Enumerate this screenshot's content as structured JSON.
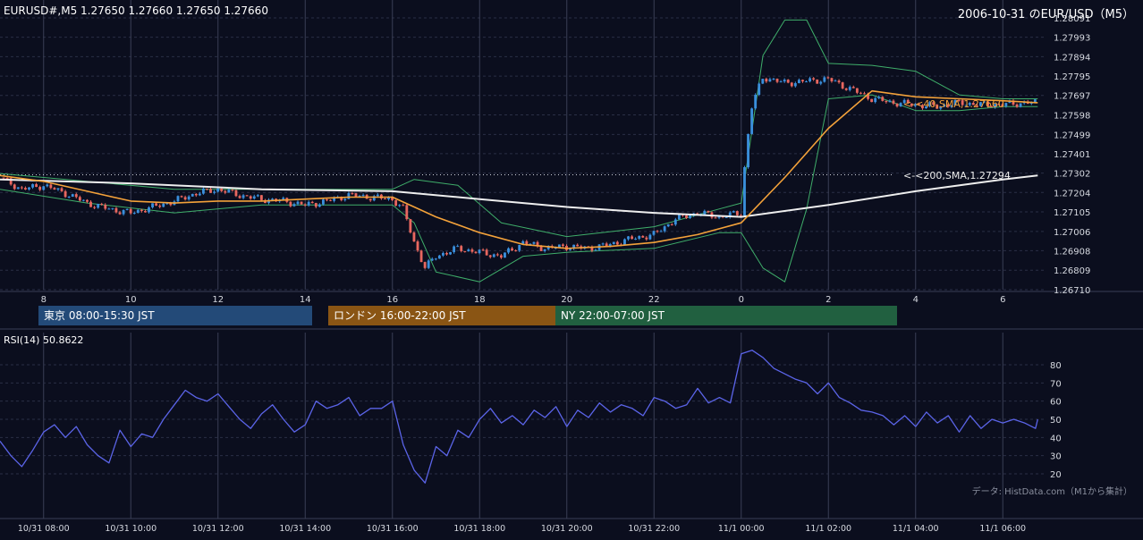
{
  "header": {
    "symbol_ohlc": "EURUSD#,M5 1.27650 1.27660 1.27650 1.27660",
    "title": "2006-10-31 のEUR/USD（M5）"
  },
  "colors": {
    "background": "#0b0e1e",
    "grid": "#2a2f45",
    "candle_up": "#3a8fdc",
    "candle_down": "#e8675f",
    "sma40": "#f4a23a",
    "sma200": "#eeeeee",
    "bollinger": "#3fae6a",
    "rsi": "#5b64e8"
  },
  "sessions": [
    {
      "label": "東京 08:00-15:30 JST",
      "color": "#234a78"
    },
    {
      "label": "ロンドン 16:00-22:00 JST",
      "color": "#8a5514"
    },
    {
      "label": "NY 22:00-07:00 JST",
      "color": "#216040"
    }
  ],
  "indicators": {
    "sma40_label": "<-<40,SMA,1.27660",
    "sma200_label": "<-<200,SMA,1.27294",
    "rsi_label": "RSI(14) 50.8622"
  },
  "source_note": "データ: HistData.com（M1から集計）",
  "chart_data": [
    {
      "type": "line",
      "name": "price",
      "y_ticks": [
        "1.28091",
        "1.27993",
        "1.27894",
        "1.27795",
        "1.27697",
        "1.27598",
        "1.27499",
        "1.27401",
        "1.27302",
        "1.27204",
        "1.27105",
        "1.27006",
        "1.26908",
        "1.26809",
        "1.26710"
      ],
      "ylim": [
        1.2671,
        1.28091
      ],
      "x_ticks": [
        "8",
        "10",
        "12",
        "14",
        "16",
        "18",
        "20",
        "22",
        "0",
        "2",
        "4",
        "6"
      ],
      "x_tick_hours": [
        8,
        10,
        12,
        14,
        16,
        18,
        20,
        22,
        24,
        26,
        28,
        30
      ],
      "xlim_hours": [
        7.0,
        31.0
      ],
      "reference_line": 1.27294,
      "series": [
        {
          "name": "price",
          "x_hours": [
            7.0,
            7.5,
            8.0,
            8.5,
            9.0,
            9.5,
            10.0,
            10.5,
            11.0,
            11.5,
            12.0,
            12.5,
            13.0,
            13.5,
            14.0,
            14.5,
            15.0,
            15.5,
            16.0,
            16.25,
            16.5,
            16.75,
            17.0,
            17.5,
            18.0,
            18.5,
            19.0,
            19.5,
            20.0,
            20.5,
            21.0,
            21.5,
            22.0,
            22.5,
            23.0,
            23.5,
            24.0,
            24.1,
            24.25,
            24.5,
            25.0,
            25.5,
            26.0,
            26.5,
            27.0,
            27.5,
            28.0,
            28.5,
            29.0,
            29.5,
            30.0,
            30.5,
            30.8
          ],
          "values": [
            1.2728,
            1.2722,
            1.2724,
            1.272,
            1.2715,
            1.2712,
            1.271,
            1.2713,
            1.2716,
            1.272,
            1.2722,
            1.2719,
            1.2717,
            1.2716,
            1.2714,
            1.2716,
            1.2719,
            1.2718,
            1.2717,
            1.2712,
            1.2695,
            1.2682,
            1.2688,
            1.2692,
            1.269,
            1.2688,
            1.2695,
            1.2692,
            1.2693,
            1.2692,
            1.2694,
            1.2697,
            1.2699,
            1.2707,
            1.271,
            1.2708,
            1.271,
            1.274,
            1.2765,
            1.2779,
            1.2776,
            1.2777,
            1.2778,
            1.2773,
            1.2768,
            1.2766,
            1.2765,
            1.2764,
            1.2766,
            1.2765,
            1.2765,
            1.2766,
            1.2766
          ]
        },
        {
          "name": "SMA40",
          "x_hours": [
            7.0,
            8.0,
            9.0,
            10.0,
            11.0,
            12.0,
            13.0,
            14.0,
            15.0,
            16.0,
            16.5,
            17.0,
            18.0,
            19.0,
            20.0,
            21.0,
            22.0,
            23.0,
            24.0,
            25.0,
            26.0,
            27.0,
            28.0,
            29.0,
            30.0,
            30.8
          ],
          "values": [
            1.2729,
            1.2726,
            1.2721,
            1.2716,
            1.2715,
            1.2716,
            1.2716,
            1.2717,
            1.2718,
            1.2718,
            1.2713,
            1.2708,
            1.27,
            1.2694,
            1.2692,
            1.2693,
            1.2695,
            1.2699,
            1.2705,
            1.2728,
            1.2753,
            1.2772,
            1.2769,
            1.2768,
            1.2767,
            1.2766
          ]
        },
        {
          "name": "SMA200",
          "x_hours": [
            7.0,
            10.0,
            13.0,
            16.0,
            18.0,
            20.0,
            22.0,
            24.0,
            26.0,
            28.0,
            30.0,
            30.8
          ],
          "values": [
            1.2727,
            1.2725,
            1.2722,
            1.2721,
            1.2717,
            1.2713,
            1.271,
            1.2708,
            1.2714,
            1.2721,
            1.2727,
            1.2729
          ]
        },
        {
          "name": "BB upper",
          "x_hours": [
            7.0,
            9.0,
            11.0,
            13.0,
            15.0,
            16.0,
            16.5,
            17.5,
            18.5,
            20.0,
            22.0,
            23.5,
            24.0,
            24.5,
            25.0,
            25.5,
            26.0,
            27.0,
            28.0,
            29.0,
            30.0,
            30.8
          ],
          "values": [
            1.273,
            1.2726,
            1.2722,
            1.2722,
            1.2722,
            1.2722,
            1.2727,
            1.2724,
            1.2705,
            1.2698,
            1.2703,
            1.2712,
            1.2715,
            1.279,
            1.2808,
            1.2808,
            1.2786,
            1.2785,
            1.2782,
            1.277,
            1.2768,
            1.2768
          ]
        },
        {
          "name": "BB lower",
          "x_hours": [
            7.0,
            9.0,
            11.0,
            13.0,
            15.0,
            16.0,
            16.5,
            17.0,
            18.0,
            19.0,
            20.0,
            22.0,
            23.5,
            24.0,
            24.5,
            25.0,
            25.5,
            26.0,
            27.0,
            28.0,
            29.0,
            30.0,
            30.8
          ],
          "values": [
            1.2722,
            1.2715,
            1.271,
            1.2714,
            1.2714,
            1.2714,
            1.2705,
            1.268,
            1.2675,
            1.2688,
            1.269,
            1.2692,
            1.27,
            1.27,
            1.2682,
            1.2675,
            1.2712,
            1.2768,
            1.277,
            1.2762,
            1.2762,
            1.2764,
            1.2764
          ]
        }
      ]
    },
    {
      "type": "line",
      "name": "RSI(14)",
      "y_ticks": [
        "80",
        "70",
        "60",
        "50",
        "40",
        "30",
        "20"
      ],
      "ylim": [
        16,
        92
      ],
      "x_ticks": [
        "10/31 08:00",
        "10/31 10:00",
        "10/31 12:00",
        "10/31 14:00",
        "10/31 16:00",
        "10/31 18:00",
        "10/31 20:00",
        "10/31 22:00",
        "11/1 00:00",
        "11/1 02:00",
        "11/1 04:00",
        "11/1 06:00"
      ],
      "x_tick_hours": [
        8,
        10,
        12,
        14,
        16,
        18,
        20,
        22,
        24,
        26,
        28,
        30
      ],
      "xlim_hours": [
        7.0,
        31.0
      ],
      "series": [
        {
          "name": "RSI",
          "x_hours": [
            7.0,
            7.25,
            7.5,
            7.75,
            8.0,
            8.25,
            8.5,
            8.75,
            9.0,
            9.25,
            9.5,
            9.75,
            10.0,
            10.25,
            10.5,
            10.75,
            11.0,
            11.25,
            11.5,
            11.75,
            12.0,
            12.25,
            12.5,
            12.75,
            13.0,
            13.25,
            13.5,
            13.75,
            14.0,
            14.25,
            14.5,
            14.75,
            15.0,
            15.25,
            15.5,
            15.75,
            16.0,
            16.25,
            16.5,
            16.75,
            17.0,
            17.25,
            17.5,
            17.75,
            18.0,
            18.25,
            18.5,
            18.75,
            19.0,
            19.25,
            19.5,
            19.75,
            20.0,
            20.25,
            20.5,
            20.75,
            21.0,
            21.25,
            21.5,
            21.75,
            22.0,
            22.25,
            22.5,
            22.75,
            23.0,
            23.25,
            23.5,
            23.75,
            24.0,
            24.25,
            24.5,
            24.75,
            25.0,
            25.25,
            25.5,
            25.75,
            26.0,
            26.25,
            26.5,
            26.75,
            27.0,
            27.25,
            27.5,
            27.75,
            28.0,
            28.25,
            28.5,
            28.75,
            29.0,
            29.25,
            29.5,
            29.75,
            30.0,
            30.25,
            30.5,
            30.75,
            30.8
          ],
          "values": [
            38,
            30,
            24,
            33,
            43,
            47,
            40,
            46,
            36,
            30,
            26,
            44,
            35,
            42,
            40,
            50,
            58,
            66,
            62,
            60,
            64,
            57,
            50,
            45,
            53,
            58,
            50,
            43,
            47,
            60,
            56,
            58,
            62,
            52,
            56,
            56,
            60,
            36,
            22,
            15,
            35,
            30,
            44,
            40,
            50,
            56,
            48,
            52,
            47,
            55,
            51,
            57,
            46,
            55,
            51,
            59,
            54,
            58,
            56,
            52,
            62,
            60,
            56,
            58,
            67,
            59,
            62,
            59,
            86,
            88,
            84,
            78,
            75,
            72,
            70,
            64,
            70,
            62,
            59,
            55,
            54,
            52,
            47,
            52,
            46,
            54,
            48,
            52,
            43,
            52,
            45,
            50,
            48,
            50,
            48,
            45,
            50
          ]
        }
      ]
    }
  ]
}
